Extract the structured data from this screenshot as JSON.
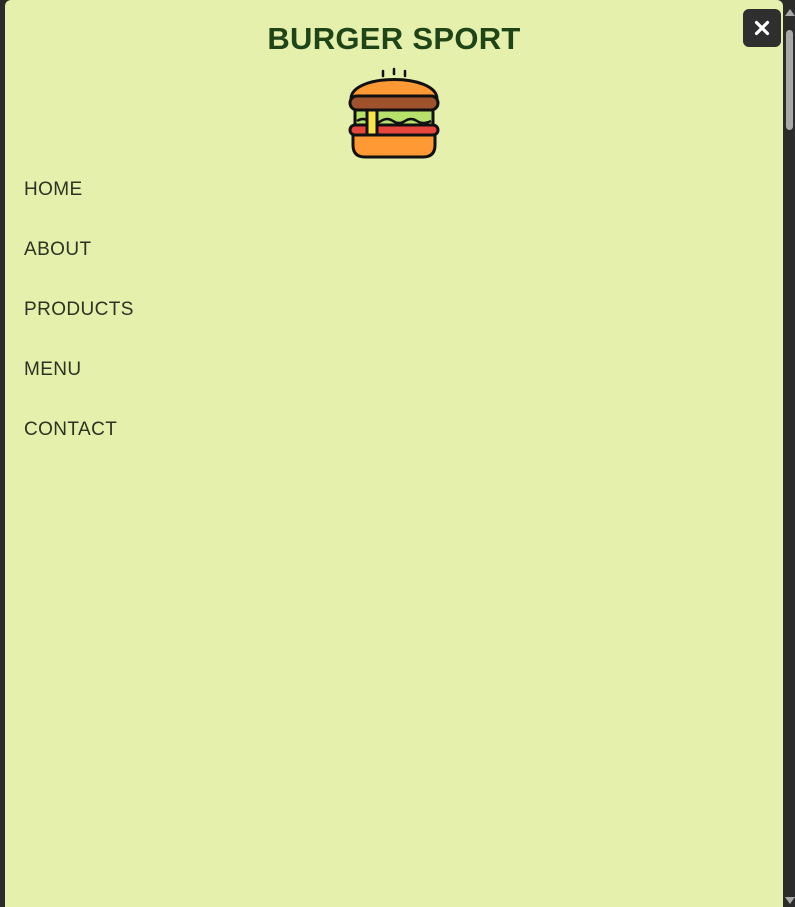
{
  "brand": {
    "title": "BURGER SPORT",
    "logo_icon": "burger-icon"
  },
  "close_button": {
    "icon": "close-icon"
  },
  "nav": {
    "items": [
      {
        "label": "HOME"
      },
      {
        "label": "ABOUT"
      },
      {
        "label": "PRODUCTS"
      },
      {
        "label": "MENU"
      },
      {
        "label": "CONTACT"
      }
    ]
  },
  "colors": {
    "drawer_background": "#e4f0ab",
    "title_text": "#1f4417",
    "nav_text": "#2d3322",
    "close_button_background": "#2f2f2f",
    "page_background": "#2b2b2b"
  }
}
